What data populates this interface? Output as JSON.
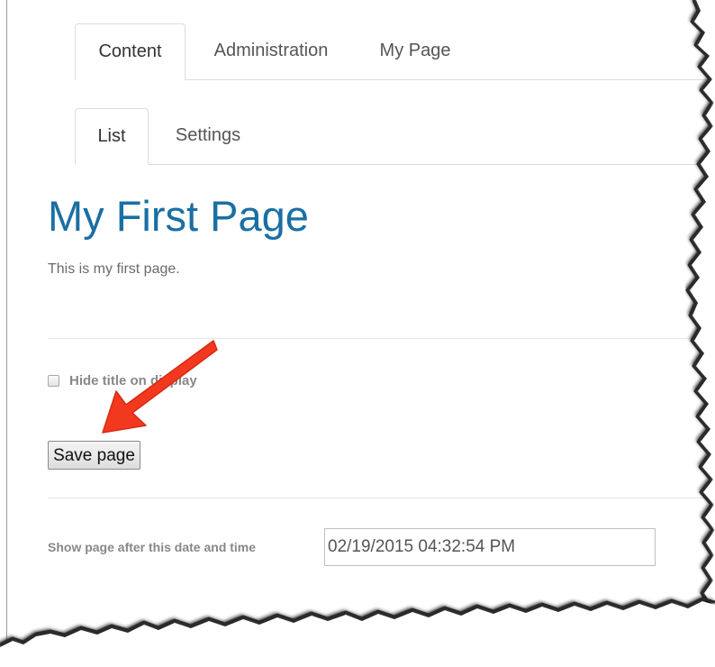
{
  "primary_tabs": [
    {
      "label": "Content",
      "active": true
    },
    {
      "label": "Administration",
      "active": false
    },
    {
      "label": "My Page",
      "active": false
    }
  ],
  "secondary_tabs": [
    {
      "label": "List",
      "active": true
    },
    {
      "label": "Settings",
      "active": false
    }
  ],
  "page": {
    "title": "My First Page",
    "body": "This is my first page."
  },
  "form": {
    "hide_title_label": "Hide title on display",
    "hide_title_checked": false,
    "save_label": "Save page",
    "date_label": "Show page after this date and time",
    "date_value": "02/19/2015 04:32:54 PM"
  },
  "colors": {
    "title": "#1a6fa3",
    "arrow": "#f2391f"
  },
  "annotation": {
    "arrow_icon": "red-arrow-icon"
  }
}
